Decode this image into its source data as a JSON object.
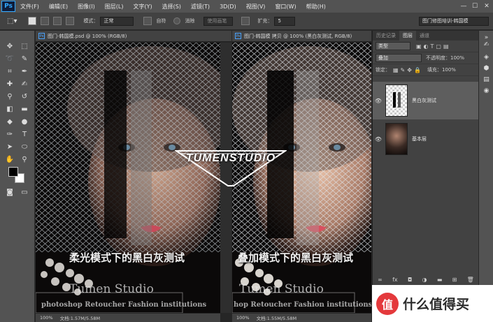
{
  "app": {
    "logo": "Ps",
    "menu": [
      "文件(F)",
      "编辑(E)",
      "图像(I)",
      "图层(L)",
      "文字(Y)",
      "选择(S)",
      "滤镜(T)",
      "3D(D)",
      "视图(V)",
      "窗口(W)",
      "帮助(H)"
    ],
    "window_controls": [
      "minimize-icon",
      "maximize-icon",
      "close-icon"
    ]
  },
  "options": {
    "mode_label": "模式：",
    "mode_value": "正常",
    "opacity_label": "自符",
    "anti_alias_label": "消除",
    "style_placeholder": "使用画笔",
    "angle_label": "扩充：",
    "angle_value": "5",
    "workspace": "图门修图培训-韩国模"
  },
  "left_doc": {
    "tab": "图门-韩国模.psd @ 100% (RGB/8)",
    "caption": "柔光模式下的黑白灰测试",
    "studio_name": "Tumen Studio",
    "studio_sub": "photoshop Retoucher Fashion institutions",
    "zoom": "100%",
    "doc_info": "文档:1.57M/5.58M"
  },
  "right_doc": {
    "tab": "图门-韩国模 拷贝 @ 100% (黑白灰测试, RGB/8)",
    "caption": "叠加模式下的黑白灰测试",
    "studio_name": "Tumen Studio",
    "studio_sub": "hop Retoucher Fashion institutions",
    "zoom": "100%",
    "doc_info": "文档:1.55M/5.58M"
  },
  "logo_overlay": "TUMENSTUDIO",
  "layers_panel": {
    "tabs": [
      "历史记录",
      "图层",
      "通道"
    ],
    "kind_label": "类型",
    "blend_mode": "叠加",
    "opacity_label": "不透明度：",
    "opacity_value": "100%",
    "lock_label": "锁定：",
    "fill_label": "填充：",
    "fill_value": "100%",
    "layers": [
      {
        "name": "黑白灰测试",
        "visible": true,
        "selected": true
      },
      {
        "name": "基本层",
        "visible": true,
        "selected": false
      }
    ],
    "bottom_icons": [
      "link-icon",
      "fx-icon",
      "mask-icon",
      "adjustment-icon",
      "group-icon",
      "new-layer-icon",
      "trash-icon"
    ]
  },
  "watermark": {
    "logo_glyph": "值",
    "text": "什么值得买"
  },
  "colors": {
    "accent": "#31a8ff",
    "watermark_red": "#e4393c"
  }
}
